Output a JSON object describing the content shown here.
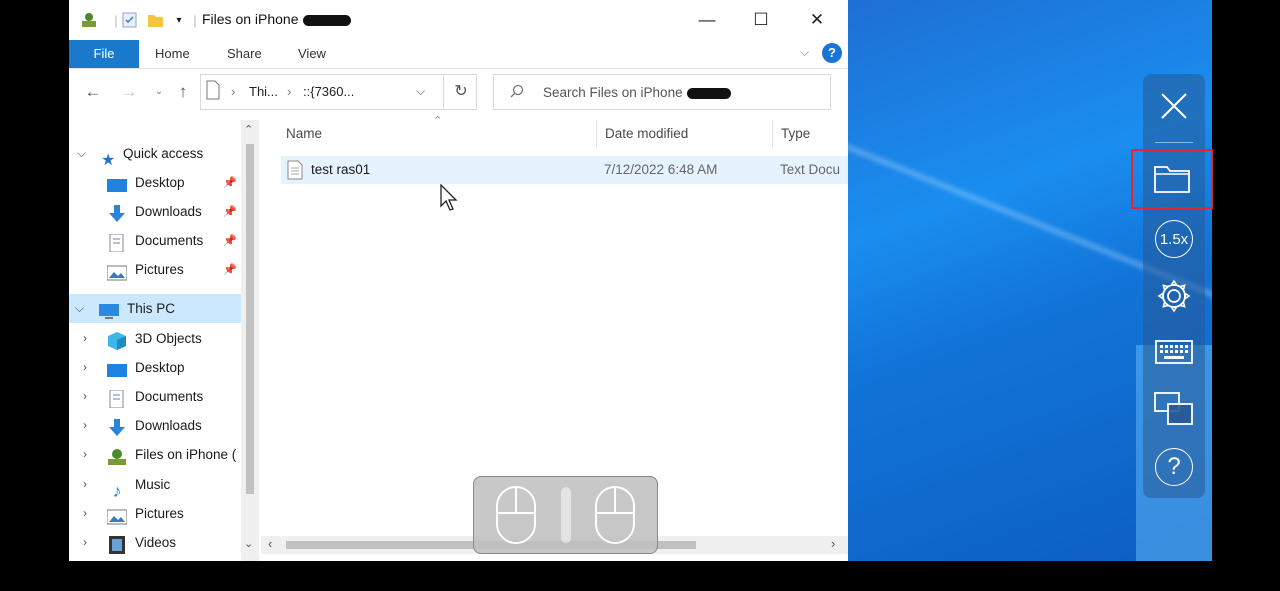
{
  "window": {
    "title": "Files on iPhone",
    "minimize": "—",
    "maximize": "☐",
    "close": "✕"
  },
  "ribbon": {
    "tabs": [
      "File",
      "Home",
      "Share",
      "View"
    ],
    "help": "?"
  },
  "address": {
    "seg1": "Thi...",
    "seg2": "::{7360...",
    "search_placeholder": "Search Files on iPhone"
  },
  "navpane": {
    "quick_access": "Quick access",
    "quick_items": [
      "Desktop",
      "Downloads",
      "Documents",
      "Pictures"
    ],
    "this_pc": "This PC",
    "pc_items": [
      "3D Objects",
      "Desktop",
      "Documents",
      "Downloads",
      "Files on iPhone (",
      "Music",
      "Pictures",
      "Videos"
    ]
  },
  "content": {
    "columns": [
      "Name",
      "Date modified",
      "Type"
    ],
    "rows": [
      {
        "name": "test ras01",
        "date": "7/12/2022 6:48 AM",
        "type": "Text Docu"
      }
    ]
  },
  "toolbar": {
    "zoom_label": "1.5x",
    "help": "?"
  },
  "colors": {
    "accent": "#1979ca",
    "selection": "#cce8ff",
    "highlight_border": "#e0262e"
  }
}
